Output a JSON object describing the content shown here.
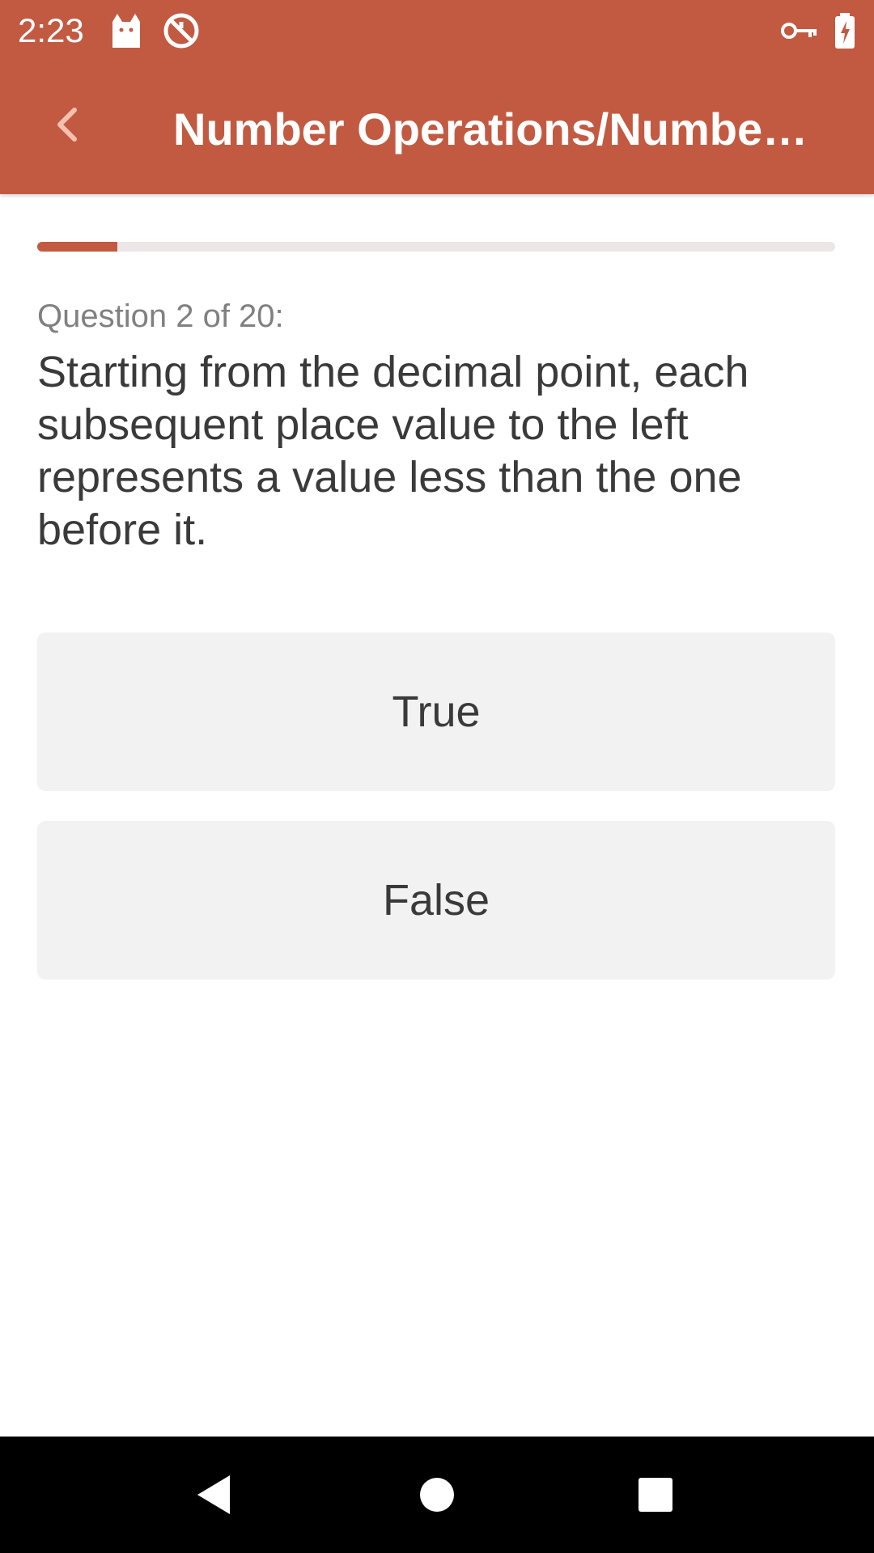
{
  "status_bar": {
    "time": "2:23",
    "icons": [
      "cat-icon",
      "no-sync-icon",
      "vpn-key-icon",
      "battery-charging-icon"
    ]
  },
  "app_bar": {
    "back_icon": "chevron-left-icon",
    "title": "Number Operations/Numbe…",
    "color": "#c25a42"
  },
  "quiz": {
    "progress_fraction": 0.1,
    "question_label": "Question 2 of 20:",
    "question_text": "Starting from the decimal point, each subsequent place value to the left represents a value less than the one before it.",
    "answers": [
      {
        "label": "True"
      },
      {
        "label": "False"
      }
    ]
  },
  "nav_bar": {
    "icons": [
      "back-triangle-icon",
      "home-circle-icon",
      "recents-square-icon"
    ]
  }
}
